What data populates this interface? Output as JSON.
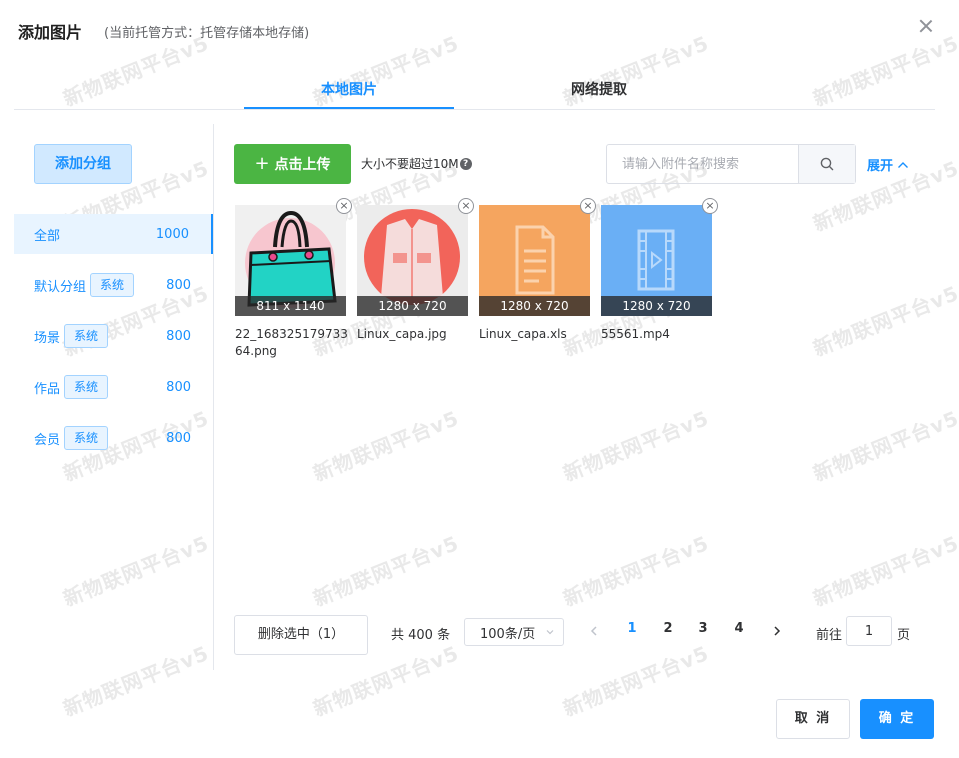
{
  "dialog": {
    "title": "添加图片",
    "subtitle": "(当前托管方式：托管存储本地存储)"
  },
  "watermark": "新物联网平台v5",
  "tabs": [
    {
      "label": "本地图片",
      "active": true
    },
    {
      "label": "网络提取",
      "active": false
    }
  ],
  "sidebar": {
    "add_group_label": "添加分组",
    "groups": [
      {
        "name": "全部",
        "tag": "",
        "count": "1000",
        "active": true
      },
      {
        "name": "默认分组",
        "tag": "系统",
        "count": "800",
        "active": false
      },
      {
        "name": "场景",
        "tag": "系统",
        "count": "800",
        "active": false
      },
      {
        "name": "作品",
        "tag": "系统",
        "count": "800",
        "active": false
      },
      {
        "name": "会员",
        "tag": "系统",
        "count": "800",
        "active": false
      }
    ]
  },
  "toolbar": {
    "upload_icon": "plus-icon",
    "upload_label": "点击上传",
    "size_hint": "大小不要超过10M",
    "search_placeholder": "请输入附件名称搜索",
    "expand_label": "展开"
  },
  "files": [
    {
      "name": "22_16832517973364.png",
      "dims": "811 x 1140",
      "kind": "image-bag"
    },
    {
      "name": "Linux_capa.jpg",
      "dims": "1280 x 720",
      "kind": "image-jacket"
    },
    {
      "name": "Linux_capa.xls",
      "dims": "1280 x 720",
      "kind": "document"
    },
    {
      "name": "55561.mp4",
      "dims": "1280 x 720",
      "kind": "video"
    }
  ],
  "footer": {
    "delete_label": "删除选中（1）",
    "total_text": "共 400 条",
    "page_size": "100条/页",
    "pages": [
      "1",
      "2",
      "3",
      "4"
    ],
    "current_page": "1",
    "goto_label": "前往",
    "goto_value": "1",
    "goto_suffix": "页"
  },
  "actions": {
    "cancel_label": "取 消",
    "ok_label": "确 定"
  },
  "colors": {
    "primary": "#1890ff",
    "upload": "#4bb543",
    "doc_thumb": "#f5a55f",
    "video_thumb": "#6aaff5",
    "jacket_circle": "#f2645a"
  }
}
